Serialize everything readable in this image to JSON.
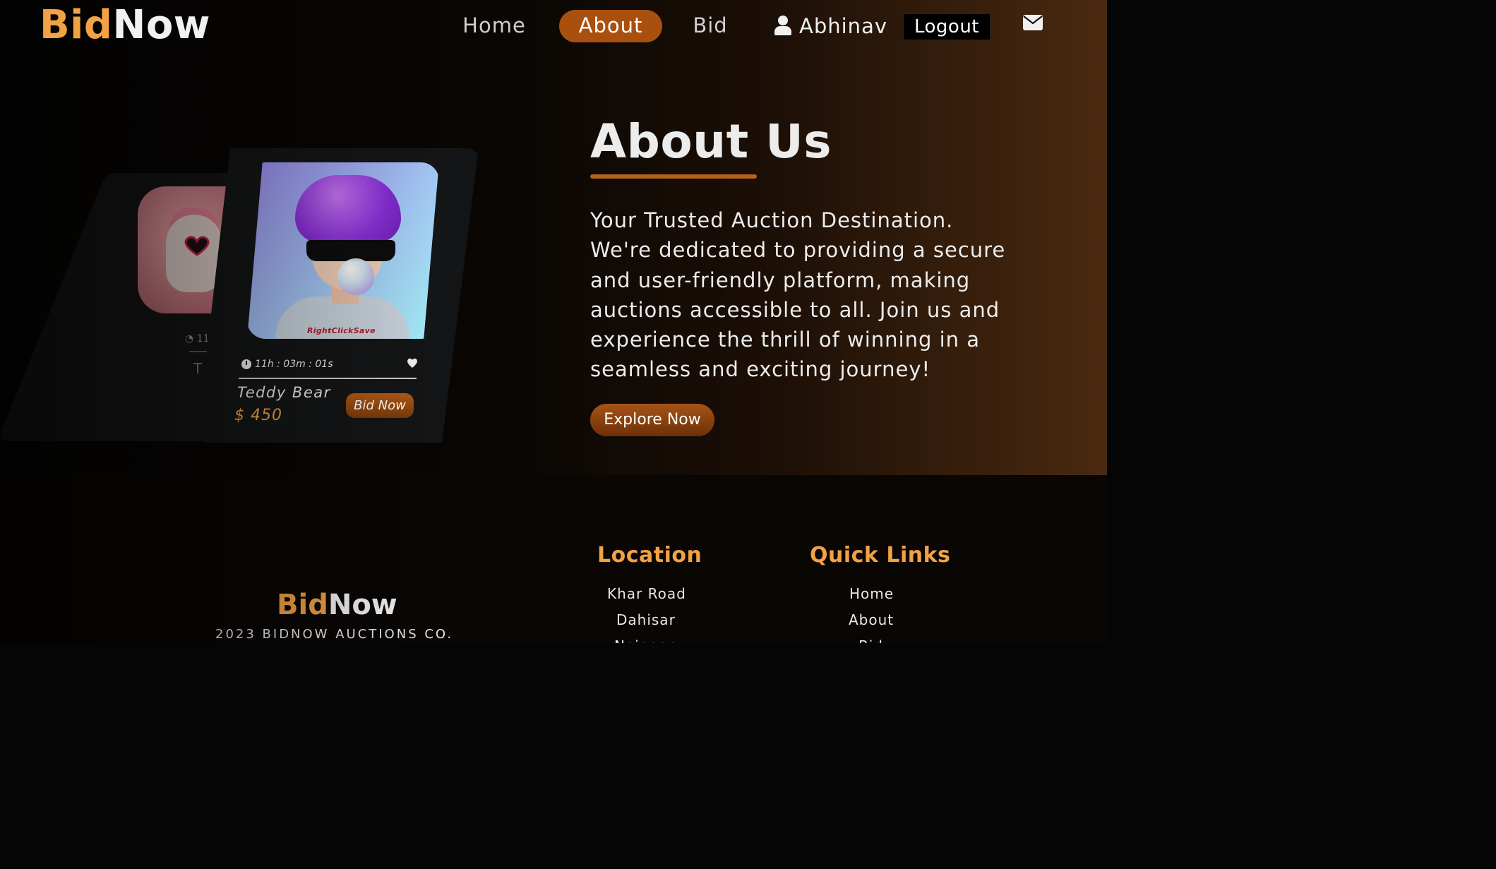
{
  "brand": {
    "part1": "Bid",
    "part2": "Now"
  },
  "nav": {
    "home": "Home",
    "about": "About",
    "bid": "Bid",
    "user_name": "Abhinav",
    "logout": "Logout"
  },
  "colors": {
    "accent": "#f2a144",
    "active_tab": "#a9500f",
    "button": "#a65317"
  },
  "icons": {
    "user": "user-icon",
    "mail": "mail-icon",
    "clock": "clock-icon",
    "heart": "heart-icon"
  },
  "card": {
    "timer": "11h : 03m : 01s",
    "name": "Teddy Bear",
    "price": "$ 450",
    "bid_button": "Bid Now",
    "image_text": "RightClickSave"
  },
  "back_card": {
    "timer_fragment": "11h",
    "name_fragment": "T"
  },
  "about": {
    "title": "About Us",
    "lines": [
      "Your Trusted Auction Destination.",
      "We're dedicated to providing a secure",
      "and user-friendly platform, making",
      "auctions accessible to all. Join us and",
      "experience the thrill of winning in a",
      "seamless and exciting journey!"
    ],
    "explore_button": "Explore Now"
  },
  "footer": {
    "brand": {
      "part1": "Bid",
      "part2": "Now"
    },
    "copyright": "2023 BIDNOW AUCTIONS CO.",
    "location_heading": "Location",
    "locations": [
      "Khar Road",
      "Dahisar",
      "Naigaon"
    ],
    "quick_links_heading": "Quick Links",
    "quick_links": [
      "Home",
      "About",
      "Bid"
    ]
  }
}
